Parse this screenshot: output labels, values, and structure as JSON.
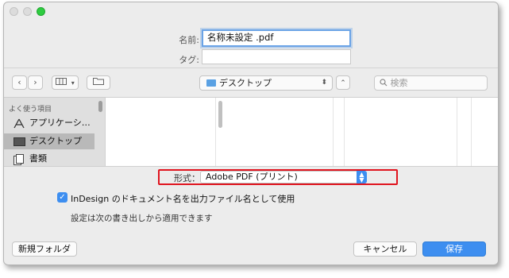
{
  "dialog": {
    "name_label": "名前:",
    "name_value": "名称未設定 .pdf",
    "tags_label": "タグ:",
    "tags_value": ""
  },
  "toolbar": {
    "back_icon": "chevron-left-icon",
    "forward_icon": "chevron-right-icon",
    "view_icon": "column-view-icon",
    "new_folder_icon": "folder-icon",
    "location": "デスクトップ",
    "search_placeholder": "検索"
  },
  "sidebar": {
    "header": "よく使う項目",
    "items": [
      {
        "label": "アプリケーシ…",
        "icon": "applications-icon"
      },
      {
        "label": "デスクトップ",
        "icon": "desktop-icon",
        "selected": true
      },
      {
        "label": "書類",
        "icon": "documents-icon"
      }
    ]
  },
  "options": {
    "format_label": "形式：",
    "format_value": "Adobe PDF (プリント)",
    "checkbox_label": "InDesign のドキュメント名を出力ファイル名として使用",
    "checkbox_checked": true,
    "note": "設定は次の書き出しから適用できます"
  },
  "buttons": {
    "new_folder": "新規フォルダ",
    "cancel": "キャンセル",
    "save": "保存"
  },
  "colors": {
    "accent": "#3d8ef0",
    "highlight_box": "#e0141e"
  }
}
